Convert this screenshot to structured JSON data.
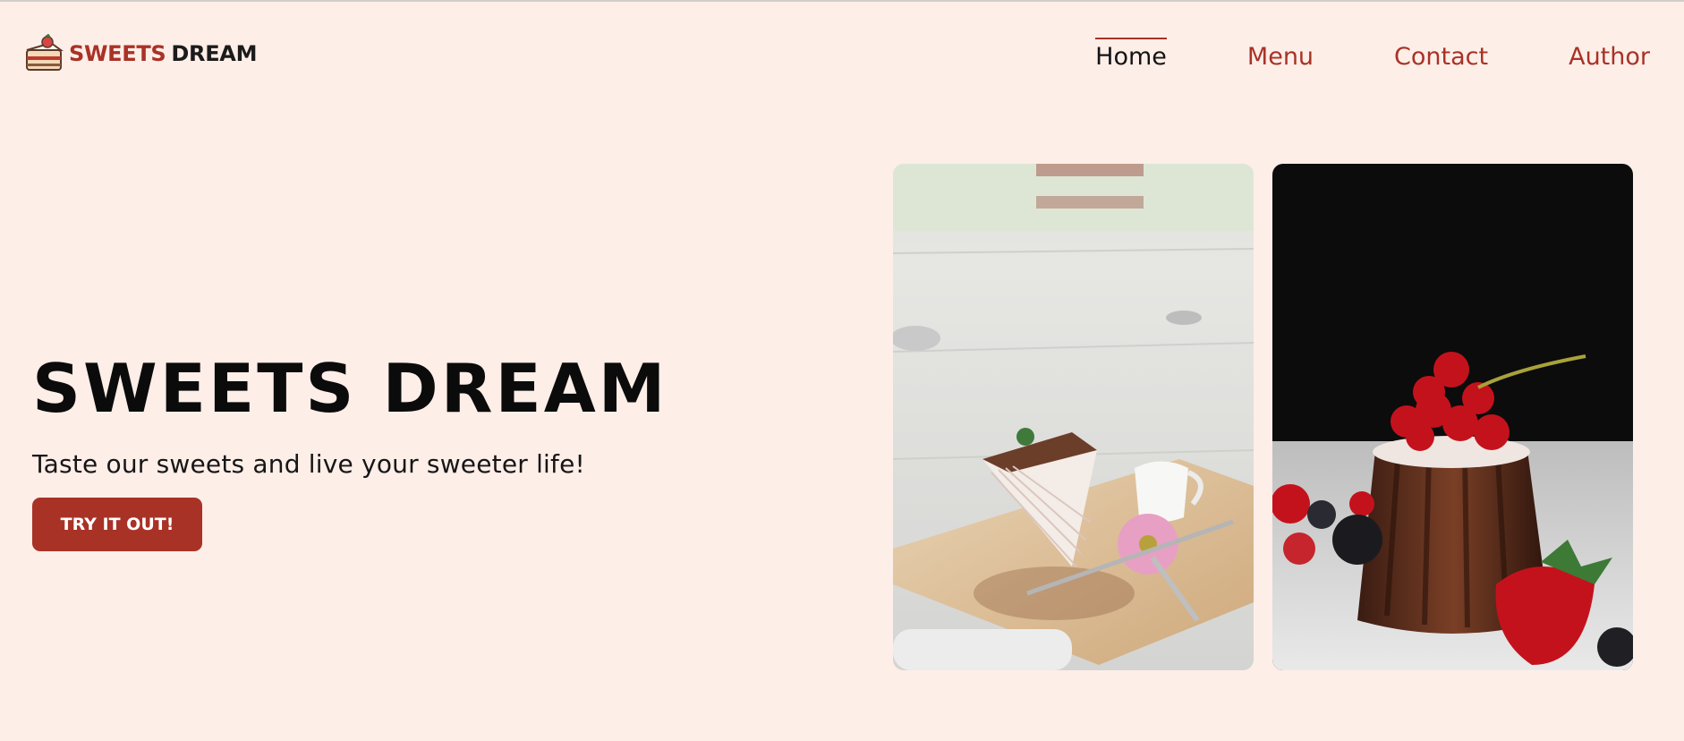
{
  "brand": {
    "name_part1": "SWEETS",
    "name_part2": "DREAM",
    "logo_icon": "cake-slice-icon"
  },
  "nav": {
    "items": [
      {
        "label": "Home",
        "active": true
      },
      {
        "label": "Menu",
        "active": false
      },
      {
        "label": "Contact",
        "active": false
      },
      {
        "label": "Author",
        "active": false
      }
    ]
  },
  "hero": {
    "title": "SWEETS DREAM",
    "subtitle": "Taste our sweets and live your sweeter life!",
    "cta_label": "TRY IT OUT!"
  },
  "photos": [
    {
      "subject": "crepe-cake-slice-photo"
    },
    {
      "subject": "chocolate-cake-with-currants-photo"
    }
  ],
  "colors": {
    "accent": "#a93226",
    "background": "#fdeee8",
    "text_dark": "#141414"
  }
}
